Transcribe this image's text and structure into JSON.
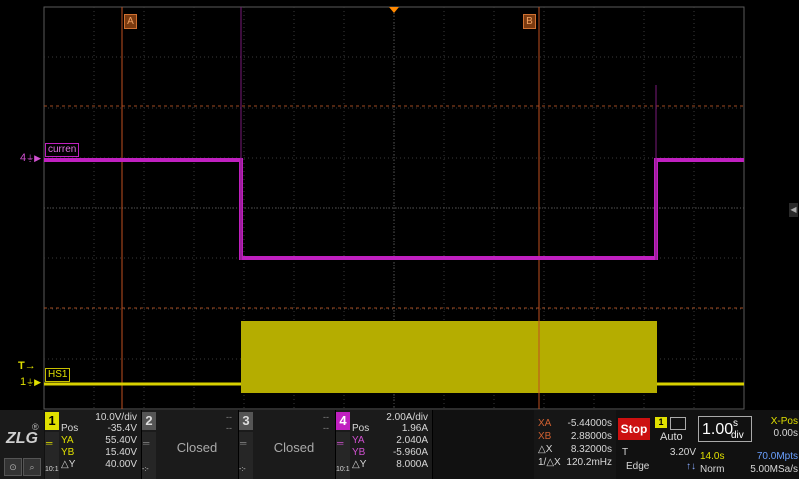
{
  "markers": {
    "a": "A",
    "b": "B"
  },
  "traces": {
    "ch4_label": "curren",
    "ch1_label": "HS1",
    "ch4_ref": "4",
    "ch1_ref": "1",
    "trigger_ref": "T"
  },
  "colors": {
    "ch1": "#d8d000",
    "ch4": "#c020c0",
    "cursor": "#c05020",
    "stop": "#cc1010"
  },
  "channels": [
    {
      "num": "1",
      "scale": "10.0V/div",
      "pos_label": "Pos",
      "pos": "-35.4V",
      "ya_label": "YA",
      "ya": "55.40V",
      "yb_label": "YB",
      "yb": "15.40V",
      "dy_label": "△Y",
      "dy": "40.00V",
      "coupling": "DC",
      "probe": "10:1"
    },
    {
      "num": "2",
      "state": "Closed",
      "scale": "--",
      "pos": "--",
      "probe": "-:-"
    },
    {
      "num": "3",
      "state": "Closed",
      "scale": "--",
      "pos": "--",
      "probe": "-:-"
    },
    {
      "num": "4",
      "scale": "2.00A/div",
      "pos_label": "Pos",
      "pos": "1.96A",
      "ya_label": "YA",
      "ya": "2.040A",
      "yb_label": "YB",
      "yb": "-5.960A",
      "dy_label": "△Y",
      "dy": "8.000A",
      "coupling": "DC",
      "probe": "10:1"
    }
  ],
  "cursors": {
    "xa_label": "XA",
    "xa": "-5.44000s",
    "xb_label": "XB",
    "xb": "2.88000s",
    "dx_label": "△X",
    "dx": "8.32000s",
    "inv_label": "1/△X",
    "inv": "120.2mHz"
  },
  "run": {
    "stop_label": "Stop"
  },
  "trigger": {
    "source": "1",
    "mode": "Auto",
    "t_label": "T",
    "level": "3.20V",
    "type": "Edge"
  },
  "timebase": {
    "scale": "1.00",
    "unit_top": "s",
    "unit_bottom": "div",
    "xpos_label": "X-Pos",
    "xpos": "0.00s",
    "record_time": "14.0s",
    "memory": "70.0Mpts",
    "acq_mode": "Norm",
    "sample_rate": "5.00MSa/s"
  },
  "logo": {
    "text": "ZLG"
  }
}
